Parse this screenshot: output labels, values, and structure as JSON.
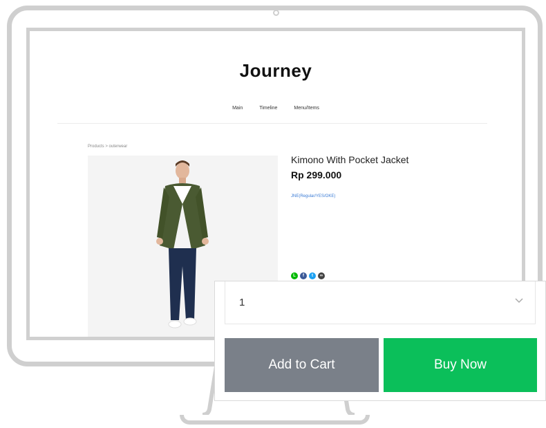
{
  "site": {
    "title": "Journey",
    "nav": [
      "Main",
      "Timeline",
      "Menu/Items"
    ]
  },
  "breadcrumb": "Products > outerwear",
  "product": {
    "name": "Kimono With Pocket Jacket",
    "price": "Rp 299.000",
    "shipping": "JNE(Regular/YES/OKE)"
  },
  "share_icons": [
    {
      "name": "line-icon",
      "color": "#00b900",
      "glyph": "L"
    },
    {
      "name": "facebook-icon",
      "color": "#3b5998",
      "glyph": "f"
    },
    {
      "name": "twitter-icon",
      "color": "#1da1f2",
      "glyph": "t"
    },
    {
      "name": "share-link-icon",
      "color": "#444444",
      "glyph": "∞"
    }
  ],
  "purchase": {
    "quantity": "1",
    "add_to_cart": "Add to Cart",
    "buy_now": "Buy Now"
  },
  "colors": {
    "cart_button": "#7a8089",
    "buy_button": "#0bbf5a"
  }
}
